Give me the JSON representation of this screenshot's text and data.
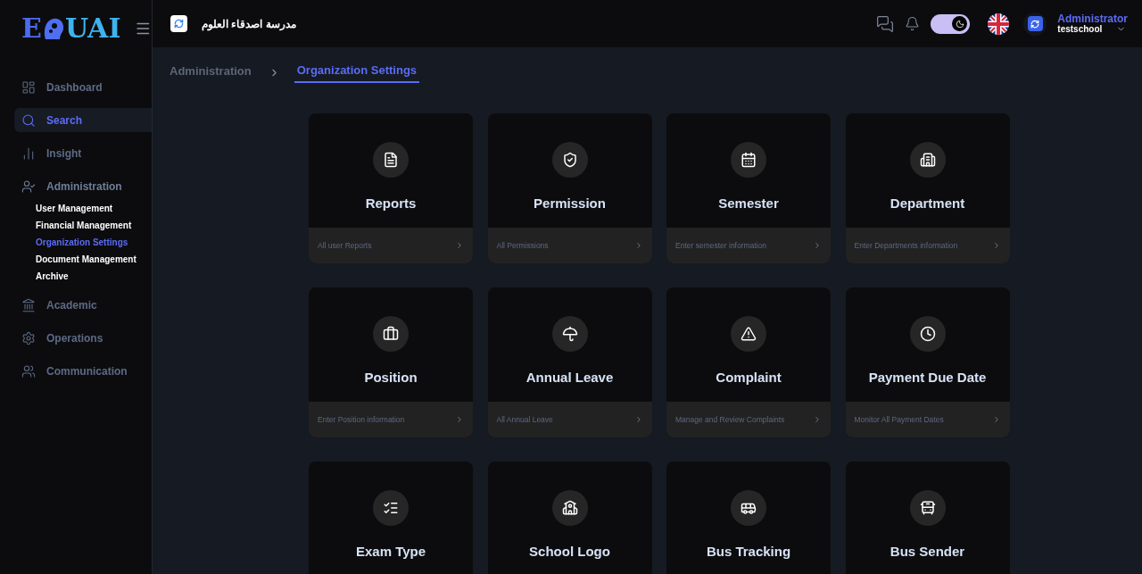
{
  "logo": {
    "left": "E",
    "right": "UAI"
  },
  "header": {
    "school_name": "مدرسة اصدقاء العلوم",
    "theme_toggle": {
      "on": true
    },
    "user": {
      "name": "Administrator",
      "account": "testschool"
    }
  },
  "sidebar": {
    "items": [
      {
        "label": "Dashboard",
        "selected": false,
        "expanded": false
      },
      {
        "label": "Search",
        "selected": true,
        "expanded": false
      },
      {
        "label": "Insight",
        "selected": false,
        "expanded": false
      },
      {
        "label": "Administration",
        "selected": false,
        "expanded": true,
        "children": [
          {
            "label": "User Management",
            "selected": false
          },
          {
            "label": "Financial Management",
            "selected": false
          },
          {
            "label": "Organization Settings",
            "selected": true
          },
          {
            "label": "Document Management",
            "selected": false
          },
          {
            "label": "Archive",
            "selected": false
          }
        ]
      },
      {
        "label": "Academic",
        "selected": false,
        "expanded": false
      },
      {
        "label": "Operations",
        "selected": false,
        "expanded": false
      },
      {
        "label": "Communication",
        "selected": false,
        "expanded": false
      }
    ]
  },
  "breadcrumb": [
    {
      "label": "Administration",
      "selected": false
    },
    {
      "label": "Organization Settings",
      "selected": true
    }
  ],
  "cards": [
    {
      "title": "Reports",
      "description": "All user Reports"
    },
    {
      "title": "Permission",
      "description": "All Permissions"
    },
    {
      "title": "Semester",
      "description": "Enter semester information"
    },
    {
      "title": "Department",
      "description": "Enter Departments information"
    },
    {
      "title": "Position",
      "description": "Enter Position information"
    },
    {
      "title": "Annual Leave",
      "description": "All Annual Leave"
    },
    {
      "title": "Complaint",
      "description": "Manage and Review Complaints"
    },
    {
      "title": "Payment Due Date",
      "description": "Monitor All Payment Dates"
    },
    {
      "title": "Exam Type"
    },
    {
      "title": "School Logo"
    },
    {
      "title": "Bus Tracking"
    },
    {
      "title": "Bus Sender"
    }
  ]
}
